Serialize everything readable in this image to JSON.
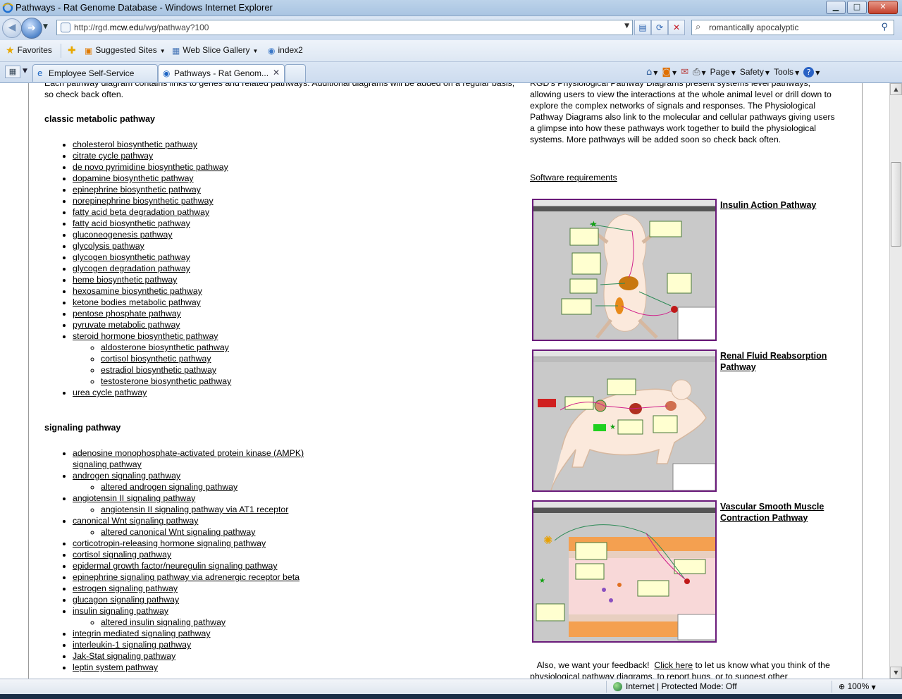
{
  "window": {
    "title": "Pathways - Rat Genome Database - Windows Internet Explorer",
    "min": "▁",
    "max": "□",
    "close": "✕"
  },
  "address": {
    "url_prefix": "http://rgd.",
    "url_host": "mcw.edu",
    "url_path": "/wg/pathway?100"
  },
  "search": {
    "value": "romantically apocalyptic"
  },
  "favorites": {
    "label": "Favorites",
    "items": [
      "Suggested Sites",
      "Web Slice Gallery",
      "index2"
    ]
  },
  "tabs": [
    {
      "label": "Employee Self-Service"
    },
    {
      "label": "Pathways - Rat Genom...",
      "active": true
    }
  ],
  "commands": [
    "Page",
    "Safety",
    "Tools"
  ],
  "content": {
    "intro": "Each pathway diagram contains links to genes and related pathways. Additional diagrams will be added on a regular basis, so check back often.",
    "metabolic": {
      "title": "classic metabolic pathway",
      "items": [
        {
          "label": "cholesterol biosynthetic pathway"
        },
        {
          "label": "citrate cycle pathway"
        },
        {
          "label": "de novo pyrimidine biosynthetic pathway"
        },
        {
          "label": "dopamine biosynthetic pathway"
        },
        {
          "label": "epinephrine biosynthetic pathway"
        },
        {
          "label": "norepinephrine biosynthetic pathway"
        },
        {
          "label": "fatty acid beta degradation pathway"
        },
        {
          "label": "fatty acid biosynthetic pathway"
        },
        {
          "label": "gluconeogenesis pathway"
        },
        {
          "label": "glycolysis pathway"
        },
        {
          "label": "glycogen biosynthetic pathway"
        },
        {
          "label": "glycogen degradation pathway"
        },
        {
          "label": "heme biosynthetic pathway"
        },
        {
          "label": "hexosamine biosynthetic pathway"
        },
        {
          "label": "ketone bodies metabolic pathway"
        },
        {
          "label": "pentose phosphate pathway"
        },
        {
          "label": "pyruvate metabolic pathway"
        },
        {
          "label": "steroid hormone biosynthetic pathway",
          "children": [
            "aldosterone biosynthetic pathway",
            "cortisol biosynthetic pathway",
            "estradiol biosynthetic pathway",
            "testosterone biosynthetic pathway"
          ]
        },
        {
          "label": "urea cycle pathway"
        }
      ]
    },
    "signaling": {
      "title": "signaling pathway",
      "items": [
        {
          "label": "adenosine monophosphate-activated protein kinase (AMPK) signaling pathway"
        },
        {
          "label": "androgen signaling pathway",
          "children": [
            "altered androgen signaling pathway"
          ]
        },
        {
          "label": "angiotensin II signaling pathway",
          "children": [
            "angiotensin II signaling pathway via AT1 receptor"
          ]
        },
        {
          "label": " canonical Wnt signaling pathway",
          "children": [
            "altered canonical Wnt signaling pathway "
          ]
        },
        {
          "label": "corticotropin-releasing hormone signaling pathway"
        },
        {
          "label": "cortisol signaling pathway"
        },
        {
          "label": "epidermal growth factor/neuregulin signaling pathway"
        },
        {
          "label": "epinephrine signaling pathway via adrenergic receptor beta"
        },
        {
          "label": "estrogen signaling pathway"
        },
        {
          "label": "glucagon signaling pathway"
        },
        {
          "label": "insulin signaling pathway",
          "children": [
            "altered insulin signaling pathway"
          ]
        },
        {
          "label": "integrin mediated signaling pathway"
        },
        {
          "label": "interleukin-1 signaling pathway"
        },
        {
          "label": "Jak-Stat signaling pathway"
        },
        {
          "label": "leptin system pathway"
        }
      ]
    },
    "physiology_intro": "RGD's Physiological Pathway Diagrams present systems level pathways, allowing users to view the interactions at the whole animal level or drill down to explore the complex networks of signals and responses.  The Physiological Pathway Diagrams also link to the molecular and cellular pathways giving users a glimpse into how these pathways work together to build the physiological systems.  More pathways will be added soon so check back often.",
    "software_link": "Software requirements",
    "physio_pathways": [
      {
        "label": "Insulin Action Pathway"
      },
      {
        "label": "Renal Fluid Reabsorption Pathway"
      },
      {
        "label": "Vascular Smooth Muscle Contraction Pathway"
      }
    ],
    "feedback_pre": "   Also, we want your feedback!  ",
    "feedback_link": "Click here",
    "feedback_post": " to let us know what you think of the physiological pathway diagrams, to report bugs, or to suggest other"
  },
  "status": {
    "zone": "Internet | Protected Mode: Off",
    "zoom": "100%"
  }
}
